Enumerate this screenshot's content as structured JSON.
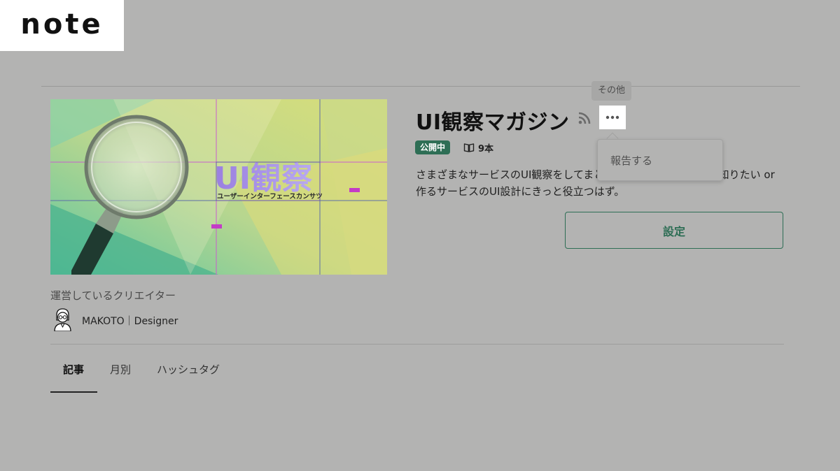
{
  "logo": {
    "text": "note"
  },
  "magazine": {
    "title": "UI観察マガジン",
    "status_badge": "公開中",
    "article_count": "9本",
    "description": "さまざまなサービスのUI観察をしてまとめています。UIについて知りたい or 作るサービスのUI設計にきっと役立つはず。",
    "settings_label": "設定",
    "thumbnail": {
      "title_text": "UI観察",
      "subtitle_text": "ユーザーインターフェースカンサツ"
    }
  },
  "more_menu": {
    "tooltip": "その他",
    "items": [
      {
        "label": "報告する"
      }
    ]
  },
  "creators": {
    "label": "運営しているクリエイター",
    "items": [
      {
        "name": "MAKOTO｜Designer"
      }
    ]
  },
  "tabs": [
    {
      "label": "記事",
      "active": true
    },
    {
      "label": "月別",
      "active": false
    },
    {
      "label": "ハッシュタグ",
      "active": false
    }
  ],
  "colors": {
    "overlay_bg": "#b3b3b2",
    "accent_green": "#2e6e55",
    "text_dark": "#111111"
  }
}
